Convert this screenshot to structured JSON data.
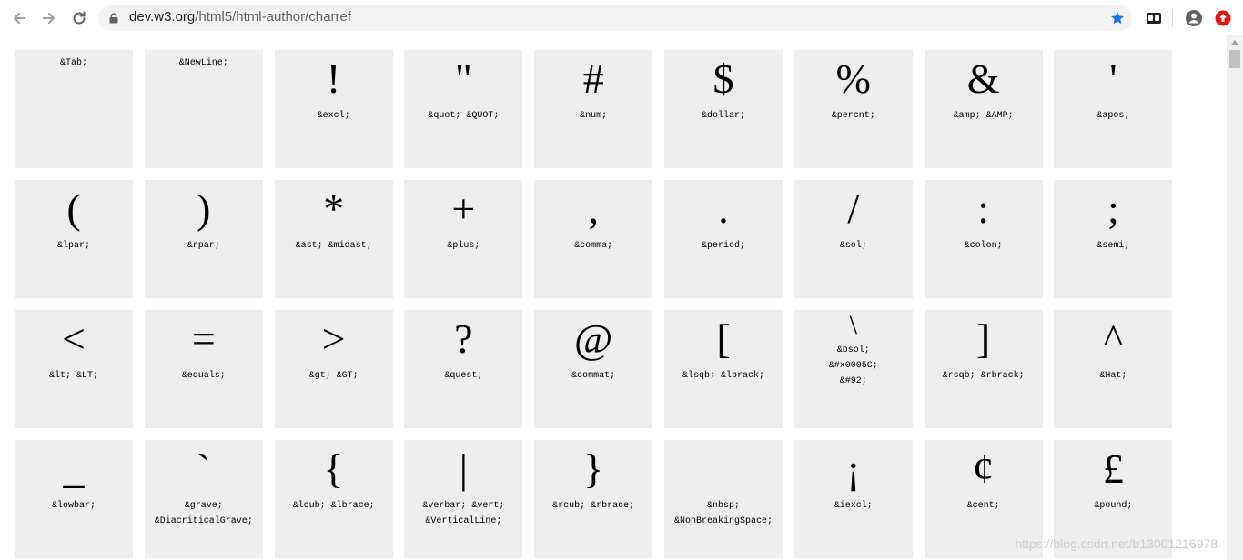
{
  "browser": {
    "url_domain": "dev.w3.org",
    "url_path": "/html5/html-author/charref",
    "icons": {
      "back": "back-arrow-icon",
      "forward": "forward-arrow-icon",
      "reload": "reload-icon",
      "lock": "lock-icon",
      "bookmark": "star-icon",
      "extension": "extension-icon",
      "profile": "profile-icon",
      "addon": "red-extension-icon"
    },
    "colors": {
      "star": "#1a73e8",
      "addon": "#e8130f"
    }
  },
  "cells": [
    {
      "glyph": "",
      "names": [
        "&Tab;"
      ]
    },
    {
      "glyph": "",
      "names": [
        "&NewLine;"
      ]
    },
    {
      "glyph": "!",
      "names": [
        "&excl;"
      ]
    },
    {
      "glyph": "\"",
      "names": [
        "&quot; &QUOT;"
      ]
    },
    {
      "glyph": "#",
      "names": [
        "&num;"
      ]
    },
    {
      "glyph": "$",
      "names": [
        "&dollar;"
      ]
    },
    {
      "glyph": "%",
      "names": [
        "&percnt;"
      ]
    },
    {
      "glyph": "&",
      "names": [
        "&amp; &AMP;"
      ]
    },
    {
      "glyph": "'",
      "names": [
        "&apos;"
      ]
    },
    {
      "glyph": "(",
      "names": [
        "&lpar;"
      ]
    },
    {
      "glyph": ")",
      "names": [
        "&rpar;"
      ]
    },
    {
      "glyph": "*",
      "names": [
        "&ast; &midast;"
      ]
    },
    {
      "glyph": "+",
      "names": [
        "&plus;"
      ]
    },
    {
      "glyph": ",",
      "names": [
        "&comma;"
      ]
    },
    {
      "glyph": ".",
      "names": [
        "&period;"
      ]
    },
    {
      "glyph": "/",
      "names": [
        "&sol;"
      ]
    },
    {
      "glyph": ":",
      "names": [
        "&colon;"
      ]
    },
    {
      "glyph": ";",
      "names": [
        "&semi;"
      ]
    },
    {
      "glyph": "<",
      "names": [
        "&lt; &LT;"
      ]
    },
    {
      "glyph": "=",
      "names": [
        "&equals;"
      ]
    },
    {
      "glyph": ">",
      "names": [
        "&gt; &GT;"
      ]
    },
    {
      "glyph": "?",
      "names": [
        "&quest;"
      ]
    },
    {
      "glyph": "@",
      "names": [
        "&commat;"
      ]
    },
    {
      "glyph": "[",
      "names": [
        "&lsqb; &lbrack;"
      ]
    },
    {
      "glyph": "\\",
      "names": [
        "&bsol;",
        "&#x0005C;",
        "&#92;"
      ],
      "small": true
    },
    {
      "glyph": "]",
      "names": [
        "&rsqb; &rbrack;"
      ]
    },
    {
      "glyph": "^",
      "names": [
        "&Hat;"
      ]
    },
    {
      "glyph": "_",
      "names": [
        "&lowbar;"
      ]
    },
    {
      "glyph": "`",
      "names": [
        "&grave;",
        "&DiacriticalGrave;"
      ]
    },
    {
      "glyph": "{",
      "names": [
        "&lcub; &lbrace;"
      ]
    },
    {
      "glyph": "|",
      "names": [
        "&verbar; &vert;",
        "&VerticalLine;"
      ]
    },
    {
      "glyph": "}",
      "names": [
        "&rcub; &rbrace;"
      ]
    },
    {
      "glyph": "",
      "names": [
        "&nbsp;",
        "&NonBreakingSpace;"
      ]
    },
    {
      "glyph": "¡",
      "names": [
        "&iexcl;"
      ]
    },
    {
      "glyph": "¢",
      "names": [
        "&cent;"
      ]
    },
    {
      "glyph": "£",
      "names": [
        "&pound;"
      ]
    }
  ],
  "watermark": "https://blog.csdn.net/b13001216978"
}
